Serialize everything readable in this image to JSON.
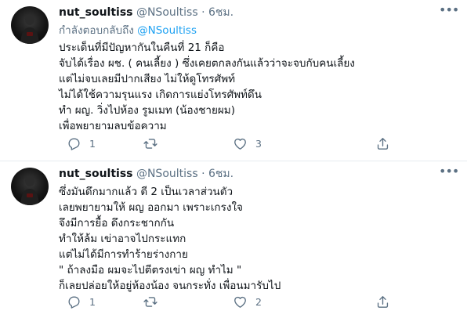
{
  "tweets": [
    {
      "display_name": "nut_soultiss",
      "handle": "@NSoultiss",
      "dot": "·",
      "time": "6ชม.",
      "more_icon": "more-horizontal-icon",
      "reply_prefix": "กำลังตอบกลับถึง ",
      "reply_mention": "@NSoultiss",
      "lines": [
        "ประเด็นที่มีปัญหากันในคืนที่ 21 ก็คือ",
        "จับได้เรื่อง ผช. ( คนเลี้ยง ) ซึ่งเคยตกลงกันแล้วว่าจะจบกับคนเลี้ยง",
        "แต่ไม่จบเลยมีปากเสียง ไม่ให้ดูโทรศัพท์",
        "ไม่ได้ใช้ความรุนแรง เกิดการแย่งโทรศัพท์ดึน",
        "ทำ ผญ. วิ่งไปห้อง รูมเมท (น้องชายผม)",
        "เพื่อพยายามลบข้อความ"
      ],
      "actions": {
        "reply_count": "1",
        "retweet_count": "",
        "like_count": "3"
      }
    },
    {
      "display_name": "nut_soultiss",
      "handle": "@NSoultiss",
      "dot": "·",
      "time": "6ชม.",
      "more_icon": "more-horizontal-icon",
      "lines": [
        "ซึ่งมันดึกมากแล้ว ตี 2 เป็นเวลาส่วนตัว",
        "เลยพยายามให้ ผญ ออกมา เพราะเกรงใจ",
        "จึงมีการยื้อ ดึงกระชากกัน",
        "ทำให้ล้ม เข่าอาจไปกระแทก",
        "แต่ไม่ได้มีการทำร้ายร่างกาย",
        "\" ถ้าลงมือ ผมจะไปตีตรงเข่า ผญ ทำไม \"",
        "ก็เลยปล่อยให้อยู่ห้องน้อง จนกระทั่ง เพื่อนมารับไป"
      ],
      "actions": {
        "reply_count": "1",
        "retweet_count": "",
        "like_count": "2"
      }
    }
  ],
  "icons": {
    "reply": "reply-icon",
    "retweet": "retweet-icon",
    "like": "heart-icon",
    "share": "share-icon"
  },
  "colors": {
    "text": "#0f1419",
    "secondary": "#5b7083",
    "link": "#1da1f2",
    "divider": "#e6ecf0"
  }
}
